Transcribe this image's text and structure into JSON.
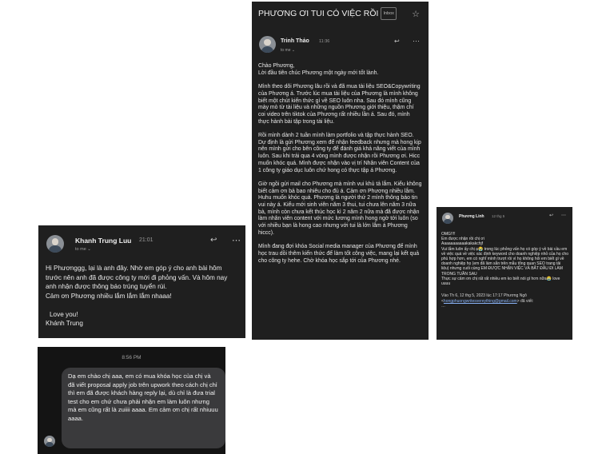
{
  "khanh_email": {
    "sender": "Khanh Trung Luu",
    "time": "21:01",
    "to": "to me",
    "reply_icon": "reply-arrow-icon",
    "more_icon": "more-horizontal-icon",
    "body": [
      "Hi Phươnggg, lại là anh đây. Nhờ em góp ý cho anh bài hôm trước nên anh đã được công ty mới đi phỏng vấn. Và hôm nay anh nhận được thông báo trúng tuyển rùi.",
      "Cảm ơn Phương nhiều lắm lắm lắm nhaaa!",
      "Love you!",
      "Khánh Trung"
    ]
  },
  "thao_email": {
    "subject": "PHƯƠNG ƠI TUI CÓ VIỆC RỒI",
    "inbox_badge": "Inbox",
    "star_icon": "star-outline-icon",
    "sender": "Trinh Thảo",
    "time": "11:36",
    "to": "to me",
    "reply_icon": "reply-arrow-icon",
    "more_icon": "more-horizontal-icon",
    "body": [
      "Chào Phương,\nLời đầu tiên chúc Phương một ngày mới tốt lành.",
      "Mình theo dõi Phương lâu rồi và đã mua tài liệu SEO&Copywriting của Phương á. Trước lúc mua tài liệu của Phương là mình không biết một chút kiến thức gì về SEO luôn nha. Sau đó mình cũng mày mò từ tài liệu và những nguồn Phương giới thiệu, thậm chí coi video trên tiktok của Phương rất nhiều lần á. Sau đó, mình thực hành bài tập trong tài liệu.",
      "Rồi mình dành 2 tuần mình làm portfolio và tập thực hành SEO. Dự định là gửi Phương xem để nhận feedback nhưng mà hong kịp nên mình gửi cho bên công ty để đánh giá khả năng viết của mình luôn. Sau khi trải qua 4 vòng mình được nhận rồi Phương ơi. Hicc muốn khóc quá. Mình được nhận vào vị trí Nhân viên Content của 1 công ty giáo dục luôn chứ hong có thực tập á Phương.",
      "Giờ ngồi gửi mail cho Phương mà mình vui khủ tả lắm. Kiểu không biết cảm ơn bả bao nhiêu cho đủ á. Cảm ơn Phương nhiều lắm. Huhu muốn khóc quá. Phương là người thứ 2 mình thông báo tin vui này á. Kiểu mới sinh viên năm 3 thui, tui chưa lên năm 3 nữa bà, mình còn chưa kết thúc học kì 2 năm 2 nữa mà đã được nhận làm nhân viên content với mức lương mình hong ngờ tới luôn (so với nhiều bạn là hong cao nhưng với tui là lớn lắm á Phương hiccc).",
      "Mình đang đợi khóa Social media manager của Phương để mình học trau dồi thêm kiến thức để làm tốt công việc, mang lại kết quả cho công ty hehe. Chờ khóa học sắp tới của Phương nhé."
    ]
  },
  "linh_email": {
    "sender": "Phương Linh",
    "time": "12 thg 5",
    "reply_icon": "reply-arrow-icon",
    "more_icon": "more-horizontal-icon",
    "body": [
      "OMG!!!!",
      "Em được nhận rồi chị ơi",
      "Aaaaaaaaaaakakakchjf",
      "Vui lắm luôn ấy chị ạ😭 trong lúc phỏng vấn họ có góp ý về bài cầu em về việc quá về việc xác định keyword cho doanh nghiệp nhỏ của họ cho phù hợp hơn, em có nghĩ mình trượt rồi vì họ không hỏi em biết gì về doanh nghiệp họ (em đã làm sẵn trên mẫu tổng quan SEO trang tải liệu) nhưng cuối cùng EM ĐƯỢC NHẬN VIỆC VÀ BẮT ĐẦU ĐI LÀM TRONG TUẦN SAU",
      "Thực sự cảm ơn chị rất rất nhiều em ko biết nói gì hơn nữa😭 love uuuu"
    ],
    "quote_prefix": "Vào Th 6, 12 thg 5, 2023 lúc 17:17 Phương Ngô <",
    "quote_link": "hongphuongwritesvereything@gmail.com",
    "quote_suffix": "> đã viết:",
    "quote_end": "…"
  },
  "sms": {
    "timestamp": "8:56 PM",
    "message": "Dạ em chào chị aaa, em có mua khóa học của chị và đã viết proposal apply job trên upwork theo cách chị chỉ thì em đã được khách hàng reply lại, dù chỉ là đưa trial test cho em chứ chưa phải nhận em làm luôn nhưng mà em cũng rất là zuiiii aaaa. Em cảm ơn chị rất nhiuuu aaaa."
  }
}
